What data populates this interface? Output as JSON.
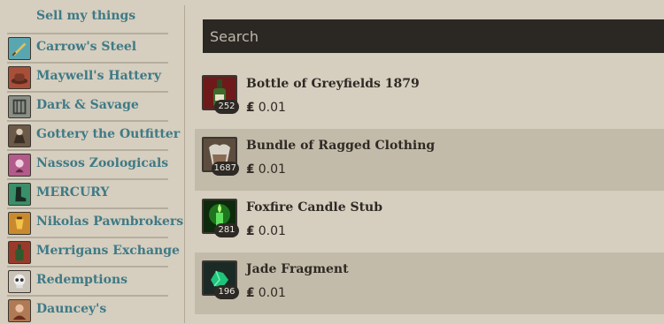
{
  "sidebar": {
    "title": "Sell my things",
    "shops": [
      {
        "label": "Carrow's Steel",
        "icon": "sword-icon",
        "color": "#5aa6b0"
      },
      {
        "label": "Maywell's Hattery",
        "icon": "hat-icon",
        "color": "#a84f3a"
      },
      {
        "label": "Dark & Savage",
        "icon": "cage-icon",
        "color": "#8a8f86"
      },
      {
        "label": "Gottery the Outfitter",
        "icon": "outfitter-icon",
        "color": "#6b5a48"
      },
      {
        "label": "Nassos Zoologicals",
        "icon": "creature-icon",
        "color": "#b35b8a"
      },
      {
        "label": "MERCURY",
        "icon": "boot-icon",
        "color": "#3a8f6a"
      },
      {
        "label": "Nikolas Pawnbrokers",
        "icon": "lamp-icon",
        "color": "#c98a2e"
      },
      {
        "label": "Merrigans Exchange",
        "icon": "bottle-icon",
        "color": "#9b3a2a"
      },
      {
        "label": "Redemptions",
        "icon": "skull-icon",
        "color": "#c9c2b6"
      },
      {
        "label": "Dauncey's",
        "icon": "portrait-icon",
        "color": "#b07a55"
      }
    ]
  },
  "search": {
    "placeholder": "Search"
  },
  "items": [
    {
      "name": "Bottle of Greyfields 1879",
      "qty": "252",
      "price": "0.01",
      "icon": "wine-bottle-icon",
      "color": "#8a2020"
    },
    {
      "name": "Bundle of Ragged Clothing",
      "qty": "1687",
      "price": "0.01",
      "icon": "clothing-icon",
      "color": "#6d5a4a"
    },
    {
      "name": "Foxfire Candle Stub",
      "qty": "281",
      "price": "0.01",
      "icon": "candle-icon",
      "color": "#2fbf2f"
    },
    {
      "name": "Jade Fragment",
      "qty": "196",
      "price": "0.01",
      "icon": "jade-icon",
      "color": "#1fc47a"
    }
  ],
  "currency_symbol": "₤"
}
